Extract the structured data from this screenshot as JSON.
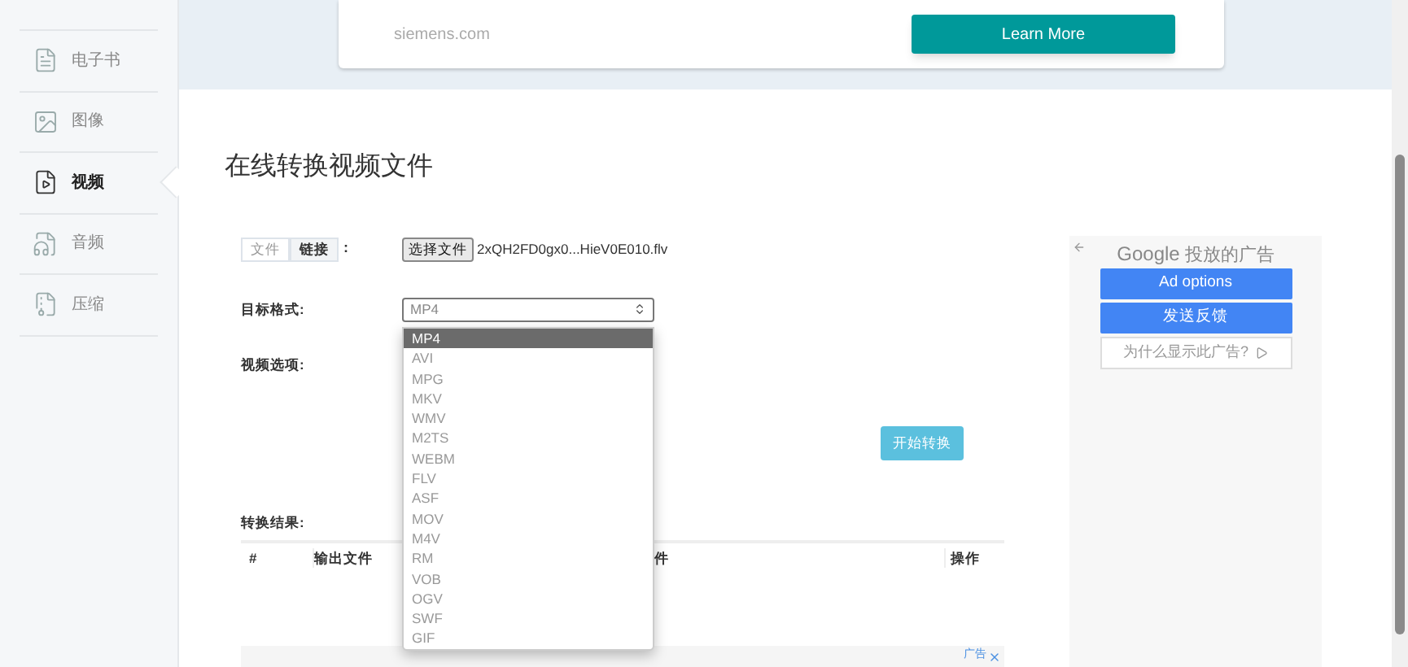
{
  "sidebar": {
    "items": [
      {
        "label": "电子书",
        "kind": "ebook",
        "selected": false
      },
      {
        "label": "图像",
        "kind": "image",
        "selected": false
      },
      {
        "label": "视频",
        "kind": "video",
        "selected": true
      },
      {
        "label": "音频",
        "kind": "audio",
        "selected": false
      },
      {
        "label": "压缩",
        "kind": "archive",
        "selected": false
      }
    ]
  },
  "top_ad": {
    "domain": "siemens.com",
    "button": "Learn More"
  },
  "title": "在线转换视频文件",
  "form": {
    "source_tabs": [
      {
        "label": "文件",
        "selected": false
      },
      {
        "label": "链接",
        "selected": true
      }
    ],
    "source_colon": ":",
    "file_button": "选择文件",
    "file_name": "2xQH2FD0gx0...HieV0E010.flv",
    "format_label": "目标格式:",
    "format_value": "MP4",
    "format_options": [
      {
        "label": "MP4",
        "selected": true
      },
      {
        "label": "AVI",
        "selected": false
      },
      {
        "label": "MPG",
        "selected": false
      },
      {
        "label": "MKV",
        "selected": false
      },
      {
        "label": "WMV",
        "selected": false
      },
      {
        "label": "M2TS",
        "selected": false
      },
      {
        "label": "WEBM",
        "selected": false
      },
      {
        "label": "FLV",
        "selected": false
      },
      {
        "label": "ASF",
        "selected": false
      },
      {
        "label": "MOV",
        "selected": false
      },
      {
        "label": "M4V",
        "selected": false
      },
      {
        "label": "RM",
        "selected": false
      },
      {
        "label": "VOB",
        "selected": false
      },
      {
        "label": "OGV",
        "selected": false
      },
      {
        "label": "SWF",
        "selected": false
      },
      {
        "label": "GIF",
        "selected": false
      }
    ],
    "options_label": "视频选项:",
    "start_button": "开始转换"
  },
  "results": {
    "label": "转换结果:",
    "columns": [
      "#",
      "输出文件",
      "件",
      "操作"
    ]
  },
  "bottom_ad": {
    "label": "广告"
  },
  "side_ad": {
    "brand": "Google",
    "brand_suffix": "投放的广告",
    "buttons": [
      "Ad options",
      "发送反馈"
    ],
    "why": "为什么显示此广告?"
  }
}
